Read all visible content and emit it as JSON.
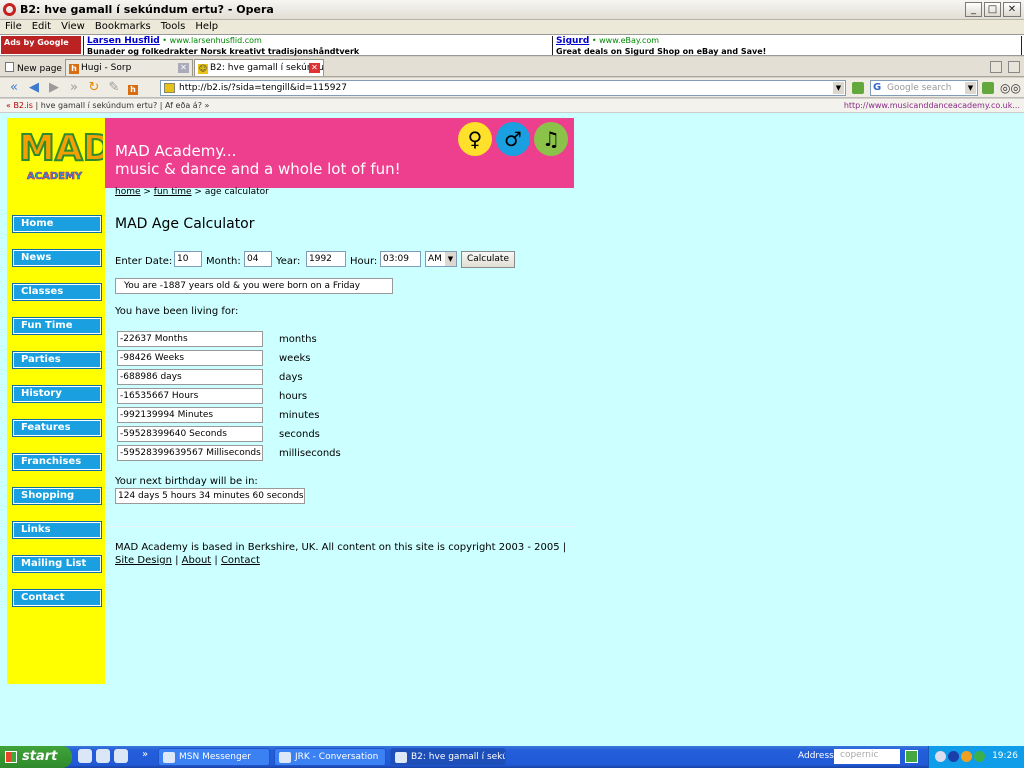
{
  "window": {
    "title": "B2: hve gamall í sekúndum ertu? - Opera",
    "buttons": {
      "minimize": "_",
      "maximize": "□",
      "close": "✕"
    }
  },
  "menu": [
    "File",
    "Edit",
    "View",
    "Bookmarks",
    "Tools",
    "Help"
  ],
  "ads": {
    "ads_by": "Ads by Google",
    "ad1": {
      "title": "Larsen Husflid",
      "url": "www.larsenhusflid.com",
      "desc": "Bunader og folkedrakter Norsk kreativt tradisjonshåndtverk"
    },
    "ad2": {
      "title": "Sigurd",
      "url": "www.eBay.com",
      "desc": "Great deals on Sigurd Shop on eBay and Save!"
    }
  },
  "tabs": {
    "new_page": "New page",
    "tab1": "Hugi - Sorp",
    "tab2": "B2: hve gamall í sekúndu..."
  },
  "nav": {
    "address": "http://b2.is/?sida=tengill&id=115927",
    "search_placeholder": "Google search"
  },
  "strip": {
    "left_prefix": "« B2.is",
    "left_text": " | hve gamall í sekúndum ertu? | Af eða á? »",
    "right_url": "http://www.musicanddanceacademy.co.uk..."
  },
  "site": {
    "logo_text": "ACADEMY",
    "banner_line1": "MAD Academy...",
    "banner_line2": "music & dance and a whole lot of fun!",
    "nav_items": [
      "Home",
      "News",
      "Classes",
      "Fun Time",
      "Parties",
      "History",
      "Features",
      "Franchises",
      "Shopping",
      "Links",
      "Mailing List",
      "Contact"
    ],
    "breadcrumb": {
      "home": "home",
      "sep1": " > ",
      "fun": "fun time",
      "sep2": " > ",
      "current": "age calculator"
    },
    "heading": "MAD Age Calculator",
    "form": {
      "enter_date_label": "Enter Date:",
      "date": "10",
      "month_label": "Month:",
      "month": "04",
      "year_label": "Year:",
      "year": "1992",
      "hour_label": "Hour:",
      "hour": "03:09",
      "ampm": "AM",
      "calculate": "Calculate"
    },
    "result": "You are -1887 years old &  you were born on a Friday",
    "living_for": "You have been living for:",
    "stats": [
      {
        "value": "-22637 Months",
        "unit": "months"
      },
      {
        "value": "-98426 Weeks",
        "unit": "weeks"
      },
      {
        "value": "-688986 days",
        "unit": "days"
      },
      {
        "value": "-16535667 Hours",
        "unit": "hours"
      },
      {
        "value": "-992139994 Minutes",
        "unit": "minutes"
      },
      {
        "value": "-59528399640 Seconds",
        "unit": "seconds"
      },
      {
        "value": "-59528399639567 Milliseconds",
        "unit": "milliseconds"
      }
    ],
    "next_birthday_label": "Your next birthday will be in:",
    "next_birthday": "124 days 5 hours 34 minutes 60 seconds",
    "footer": {
      "text": "MAD Academy is based in Berkshire, UK. All content on this site is copyright 2003 - 2005 |",
      "site_design": "Site Design",
      "sep": " | ",
      "about": "About",
      "contact": "Contact"
    }
  },
  "taskbar": {
    "start": "start",
    "tasks": [
      "MSN Messenger",
      "JRK - Conversation",
      "B2: hve gamall í sekú..."
    ],
    "address_label": "Address",
    "address_value": "copernic",
    "clock": "19:26"
  }
}
